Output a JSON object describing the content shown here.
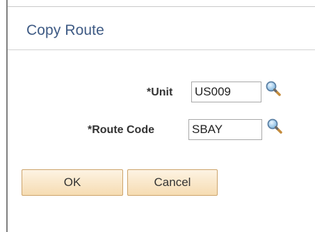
{
  "dialog": {
    "title": "Copy Route"
  },
  "form": {
    "unit": {
      "label": "*Unit",
      "value": "US009",
      "lookup_icon": "magnifier-icon"
    },
    "route_code": {
      "label": "*Route Code",
      "value": "SBAY",
      "lookup_icon": "magnifier-icon"
    }
  },
  "buttons": {
    "ok_label": "OK",
    "cancel_label": "Cancel"
  },
  "colors": {
    "title": "#3e5a84",
    "button_border": "#cca36a",
    "button_top": "#fdf3e3",
    "button_bottom": "#f6dcb2"
  }
}
